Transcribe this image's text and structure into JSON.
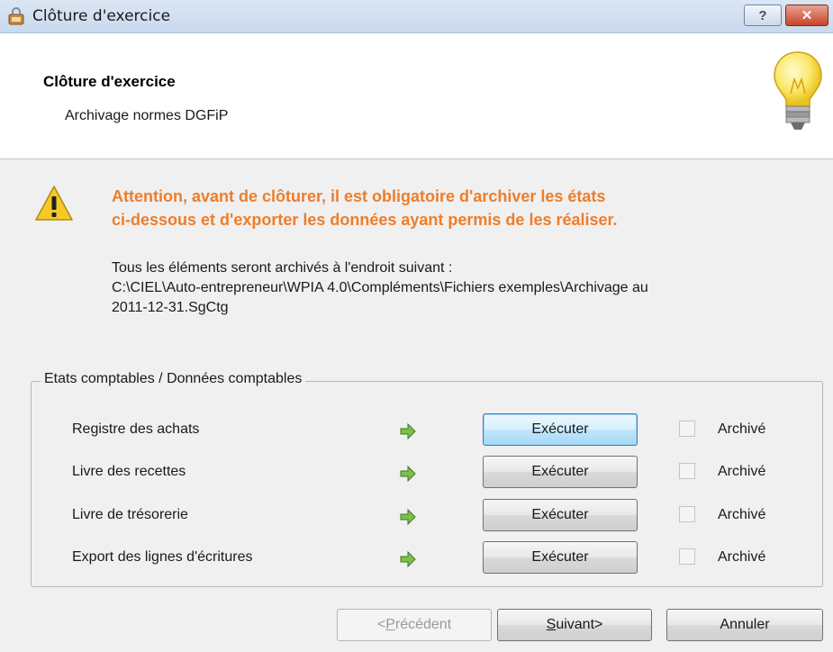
{
  "window": {
    "title": "Clôture d'exercice",
    "title_icon": "app-lock-icon",
    "help_label": "?",
    "close_label": "✕"
  },
  "header": {
    "title": "Clôture d'exercice",
    "subtitle": "Archivage normes DGFiP",
    "illustration": "lightbulb-icon"
  },
  "warning": {
    "icon": "warning-triangle-icon",
    "line1": "Attention, avant de clôturer, il est obligatoire d'archiver les états",
    "line2": "ci-dessous et d'exporter les données ayant permis de les réaliser.",
    "color": "#ee7d2a"
  },
  "info": {
    "line1": "Tous les éléments seront archivés à l'endroit suivant :",
    "line2": "C:\\CIEL\\Auto-entrepreneur\\WPIA 4.0\\Compléments\\Fichiers exemples\\Archivage au",
    "line3": "2011-12-31.SgCtg"
  },
  "group": {
    "label": "Etats comptables / Données comptables",
    "rows": [
      {
        "label": "Registre des achats",
        "button": "Exécuter",
        "check_label": "Archivé",
        "checked": false,
        "focused": true
      },
      {
        "label": "Livre des recettes",
        "button": "Exécuter",
        "check_label": "Archivé",
        "checked": false,
        "focused": false
      },
      {
        "label": "Livre de trésorerie",
        "button": "Exécuter",
        "check_label": "Archivé",
        "checked": false,
        "focused": false
      },
      {
        "label": "Export des lignes d'écritures",
        "button": "Exécuter",
        "check_label": "Archivé",
        "checked": false,
        "focused": false
      }
    ]
  },
  "footer": {
    "prev": {
      "prefix": "< ",
      "mnemonic": "P",
      "rest": "récédent",
      "enabled": false
    },
    "next": {
      "mnemonic": "S",
      "rest": "uivant",
      "suffix": " >"
    },
    "cancel": "Annuler"
  }
}
